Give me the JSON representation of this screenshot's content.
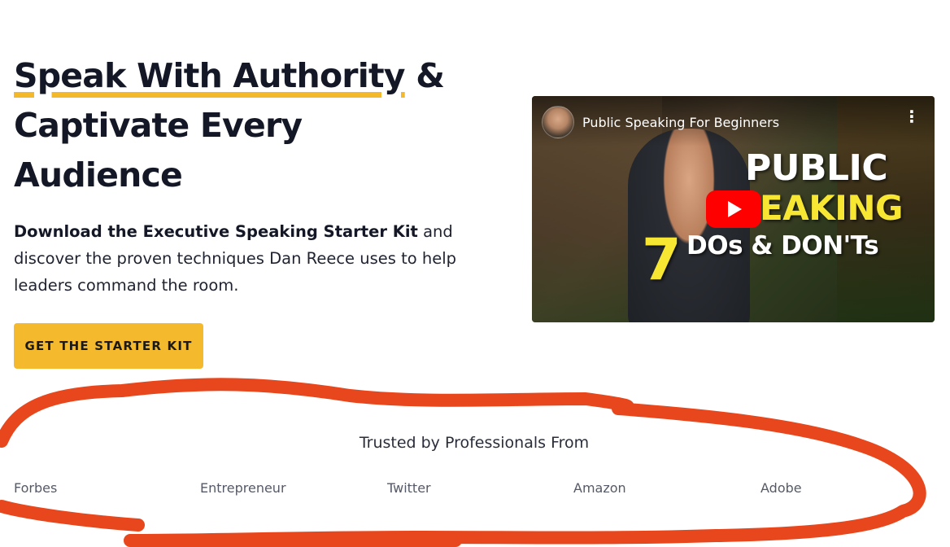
{
  "hero": {
    "headline_highlight": "Speak With Authority",
    "headline_rest": " & Captivate Every Audience",
    "intro_bold": "Download the Executive Speaking Starter Kit",
    "intro_rest": " and discover the proven techniques Dan Reece uses to help leaders command the room.",
    "cta_label": "GET THE STARTER KIT"
  },
  "video": {
    "title": "Public Speaking For Beginners",
    "thumb_line1": "PUBLIC",
    "thumb_line2": "SPEAKING",
    "thumb_number": "7",
    "thumb_line3": "DOs & DON'Ts",
    "menu_glyph": "⋮"
  },
  "trusted": {
    "title": "Trusted by Professionals From",
    "logos": [
      "Forbes",
      "Entrepreneur",
      "Twitter",
      "Amazon",
      "Adobe"
    ]
  },
  "colors": {
    "accent": "#f4b92c",
    "text": "#141826",
    "annotation": "#e8461c",
    "play": "#ff0000"
  }
}
